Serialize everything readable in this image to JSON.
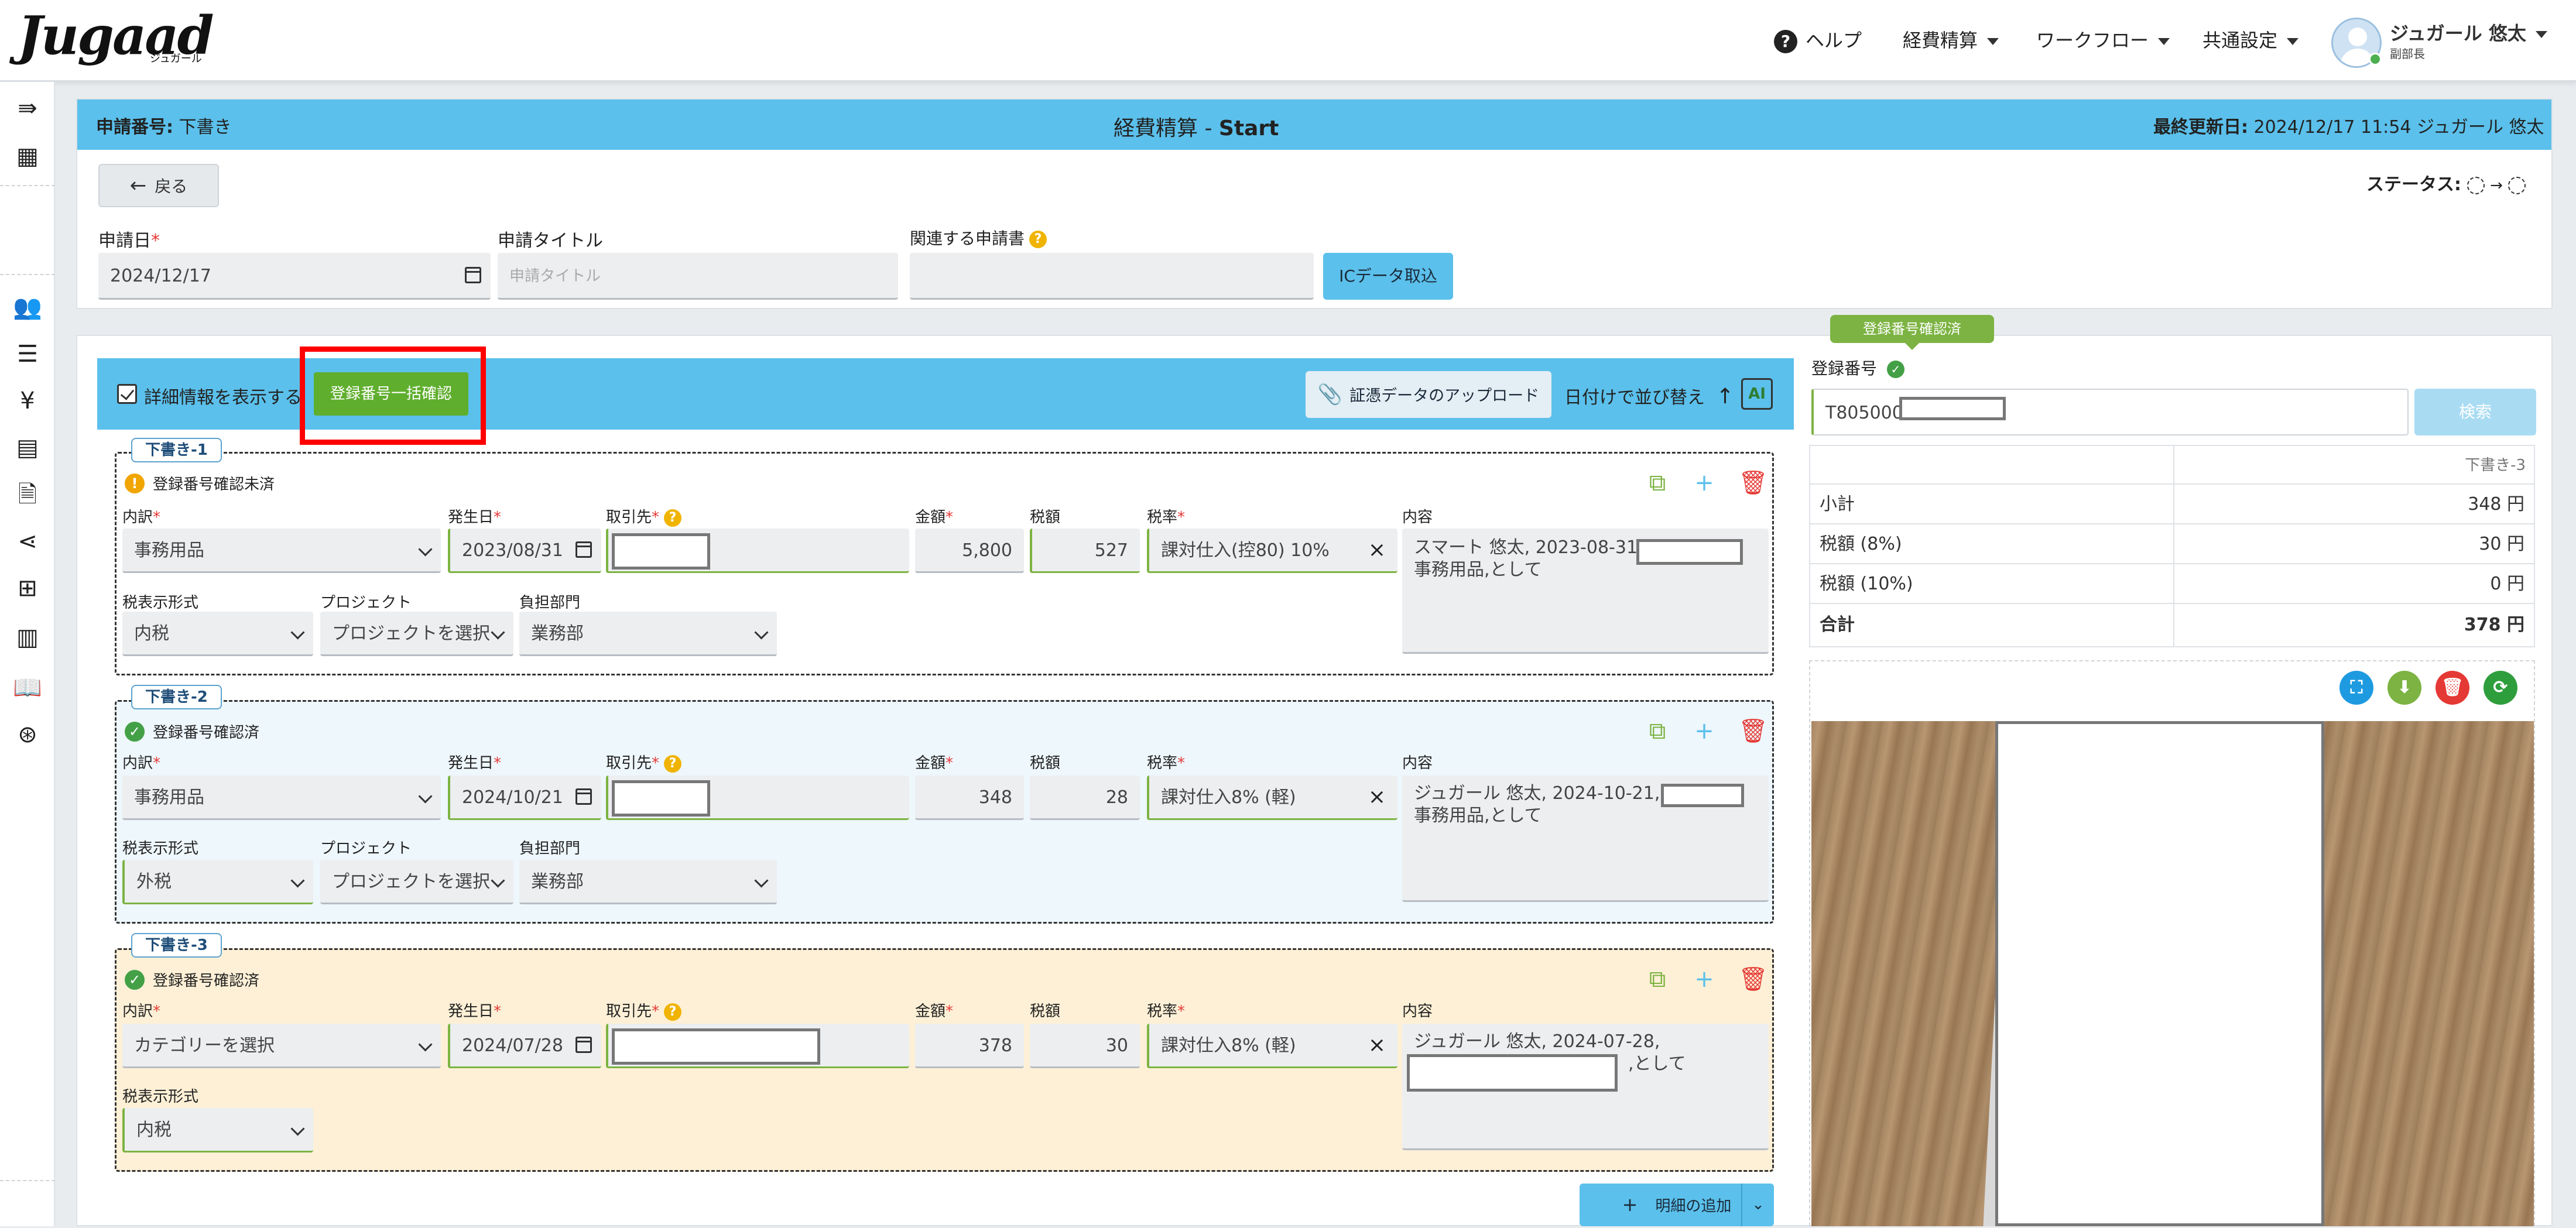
{
  "app": {
    "logo": "Jugaad",
    "logo_sub": "ジュガール"
  },
  "nav": {
    "help": "ヘルプ",
    "items": [
      "経費精算",
      "ワークフロー",
      "共通設定"
    ],
    "user_name": "ジュガール 悠太",
    "user_role": "副部長"
  },
  "header": {
    "application_no_label": "申請番号:",
    "application_no_value": "下書き",
    "title_main": "経費精算 - ",
    "title_bold": "Start",
    "last_updated_label": "最終更新日:",
    "last_updated_value": "2024/12/17 11:54 ジュガール 悠太"
  },
  "toolbar": {
    "back": "戻る",
    "status_label": "ステータス:"
  },
  "form": {
    "date_label": "申請日",
    "date_value": "2024/12/17",
    "title_label": "申請タイトル",
    "title_placeholder": "申請タイトル",
    "related_label": "関連する申請書",
    "ic_button": "ICデータ取込"
  },
  "detail": {
    "show_detail": "詳細情報を表示する",
    "bulk_verify": "登録番号一括確認",
    "upload": "証憑データのアップロード",
    "sort": "日付けで並び替え",
    "ai_label": "AI",
    "add_item": "明細の追加"
  },
  "labels": {
    "category": "内訳",
    "date": "発生日",
    "vendor": "取引先",
    "amount": "金額",
    "tax": "税額",
    "tax_rate": "税率",
    "content": "内容",
    "tax_display": "税表示形式",
    "project": "プロジェクト",
    "dept": "負担部門"
  },
  "rows": [
    {
      "tag": "下書き-1",
      "status": "登録番号確認未済",
      "category": "事務用品",
      "date": "2023/08/31",
      "amount": "5,800",
      "tax": "527",
      "tax_rate": "課対仕入(控80) 10%",
      "content_a": "スマート 悠太, 2023-08-31,",
      "content_b": "事務用品,として",
      "tax_display": "内税",
      "project": "プロジェクトを選択",
      "dept": "業務部"
    },
    {
      "tag": "下書き-2",
      "status": "登録番号確認済",
      "category": "事務用品",
      "date": "2024/10/21",
      "amount": "348",
      "tax": "28",
      "tax_rate": "課対仕入8% (軽)",
      "content_a": "ジュガール 悠太, 2024-10-21,",
      "content_b": "事務用品,として",
      "tax_display": "外税",
      "project": "プロジェクトを選択",
      "dept": "業務部"
    },
    {
      "tag": "下書き-3",
      "status": "登録番号確認済",
      "category": "カテゴリーを選択",
      "date": "2024/07/28",
      "amount": "378",
      "tax": "30",
      "tax_rate": "課対仕入8% (軽)",
      "content_a": "ジュガール 悠太, 2024-07-28,",
      "content_b": ",として",
      "tax_display": "内税"
    }
  ],
  "right": {
    "verified_badge": "登録番号確認済",
    "reg_label": "登録番号",
    "reg_value": "T805000",
    "search_btn": "検索",
    "table_header": "下書き-3",
    "table": [
      {
        "label": "小計",
        "value": "348 円"
      },
      {
        "label": "税額 (8%)",
        "value": "30 円"
      },
      {
        "label": "税額 (10%)",
        "value": "0 円"
      },
      {
        "label": "合計",
        "value": "378 円"
      }
    ]
  },
  "colors": {
    "header_blue": "#5bc0eb",
    "green": "#5fae2d",
    "highlight_red": "#ff0000",
    "row2_bg": "#eef7fc",
    "row3_bg": "#fdf0d6"
  }
}
